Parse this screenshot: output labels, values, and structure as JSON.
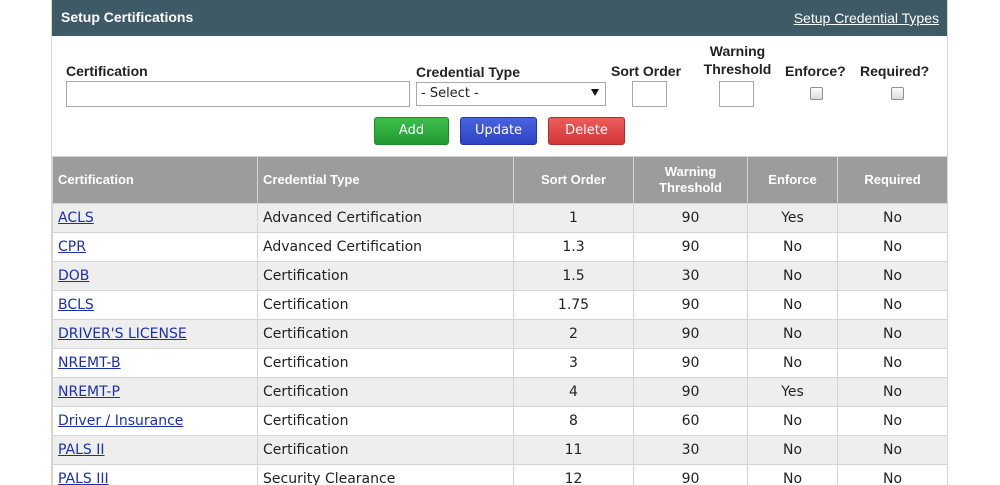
{
  "header": {
    "title": "Setup Certifications",
    "link": "Setup Credential Types"
  },
  "form": {
    "certification_label": "Certification",
    "certification_value": "",
    "credential_type_label": "Credential Type",
    "credential_type_selected": "- Select -",
    "sort_order_label": "Sort Order",
    "sort_order_value": "",
    "warning_threshold_label_1": "Warning",
    "warning_threshold_label_2": "Threshold",
    "warning_threshold_value": "",
    "enforce_label": "Enforce?",
    "enforce_checked": false,
    "required_label": "Required?",
    "required_checked": false
  },
  "buttons": {
    "add": "Add",
    "update": "Update",
    "delete": "Delete"
  },
  "table": {
    "columns": {
      "certification": "Certification",
      "credential_type": "Credential Type",
      "sort_order": "Sort Order",
      "warning_threshold_1": "Warning",
      "warning_threshold_2": "Threshold",
      "enforce": "Enforce",
      "required": "Required"
    },
    "rows": [
      {
        "certification": "ACLS",
        "credential_type": "Advanced Certification",
        "sort_order": "1",
        "warning_threshold": "90",
        "enforce": "Yes",
        "required": "No"
      },
      {
        "certification": "CPR",
        "credential_type": "Advanced Certification",
        "sort_order": "1.3",
        "warning_threshold": "90",
        "enforce": "No",
        "required": "No"
      },
      {
        "certification": "DOB",
        "credential_type": "Certification",
        "sort_order": "1.5",
        "warning_threshold": "30",
        "enforce": "No",
        "required": "No"
      },
      {
        "certification": "BCLS",
        "credential_type": "Certification",
        "sort_order": "1.75",
        "warning_threshold": "90",
        "enforce": "No",
        "required": "No"
      },
      {
        "certification": "DRIVER'S LICENSE",
        "credential_type": "Certification",
        "sort_order": "2",
        "warning_threshold": "90",
        "enforce": "No",
        "required": "No"
      },
      {
        "certification": "NREMT-B",
        "credential_type": "Certification",
        "sort_order": "3",
        "warning_threshold": "90",
        "enforce": "No",
        "required": "No"
      },
      {
        "certification": "NREMT-P",
        "credential_type": "Certification",
        "sort_order": "4",
        "warning_threshold": "90",
        "enforce": "Yes",
        "required": "No"
      },
      {
        "certification": "Driver / Insurance",
        "credential_type": "Certification",
        "sort_order": "8",
        "warning_threshold": "60",
        "enforce": "No",
        "required": "No"
      },
      {
        "certification": "PALS II",
        "credential_type": "Certification",
        "sort_order": "11",
        "warning_threshold": "30",
        "enforce": "No",
        "required": "No"
      },
      {
        "certification": "PALS III",
        "credential_type": "Security Clearance",
        "sort_order": "12",
        "warning_threshold": "90",
        "enforce": "No",
        "required": "No"
      }
    ]
  }
}
